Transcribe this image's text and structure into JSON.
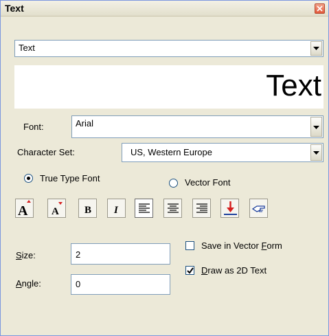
{
  "window": {
    "title": "Text"
  },
  "text_selector": {
    "value": "Text"
  },
  "preview": {
    "text": "Text"
  },
  "font": {
    "label": "Font:",
    "value": "Arial"
  },
  "charset": {
    "label": "Character Set:",
    "value": "US, Western Europe"
  },
  "font_type": {
    "true_type_label": "True Type Font",
    "vector_label": "Vector Font",
    "selected": "true_type"
  },
  "toolbar": {
    "buttons": [
      "increase-size",
      "decrease-size",
      "bold",
      "italic",
      "align-left",
      "align-center",
      "align-right",
      "insert-point",
      "pick"
    ]
  },
  "size": {
    "label_first": "S",
    "label_rest": "ize:",
    "value": "2"
  },
  "angle": {
    "label_first": "A",
    "label_rest": "ngle:",
    "value": "0"
  },
  "save_vector": {
    "label_pre": "Save in Vector ",
    "label_ul": "F",
    "label_post": "orm",
    "checked": false
  },
  "draw_2d": {
    "label_ul": "D",
    "label_post": "raw as 2D Text",
    "checked": true
  }
}
